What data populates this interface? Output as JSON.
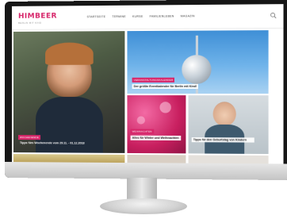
{
  "site": {
    "logo": "HIMBEER",
    "tagline": "BERLIN MIT KIND",
    "nav": [
      "STARTSEITE",
      "TERMINE",
      "KURSE",
      "FAMILIENLEBEN",
      "MAGAZIN"
    ]
  },
  "tiles": {
    "feature": {
      "tag": "WOCHENENDE",
      "caption": "Tipps fürs Wochenende vom 29.11. - 01.12.2018"
    },
    "tower": {
      "tag": "VERANSTALTUNGSKALENDER",
      "caption": "Der größte Eventkalender für Berlin mit Kind!"
    },
    "pink": {
      "tag": "WEIHNACHTEN",
      "caption": "Alles für Winter und Weihnachten"
    },
    "boy": {
      "caption": "Tipps für den Geburtstag von Kindern"
    }
  },
  "colors": {
    "brand": "#d7266a",
    "bezel": "#161616"
  }
}
